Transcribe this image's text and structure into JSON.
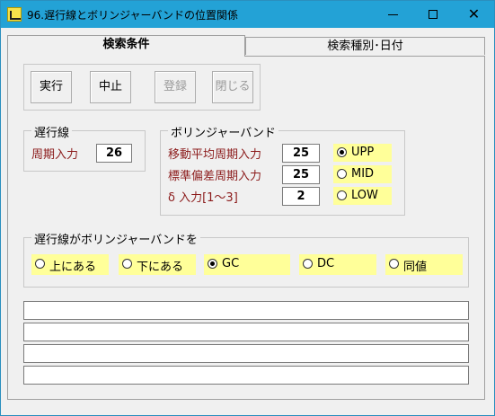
{
  "window": {
    "title": "96.遅行線とボリンジャーバンドの位置関係"
  },
  "tabs": [
    {
      "label": "検索条件",
      "active": true
    },
    {
      "label": "検索種別･日付",
      "active": false
    }
  ],
  "actions": {
    "run": "実行",
    "stop": "中止",
    "register": "登録",
    "close": "閉じる"
  },
  "lagging_line": {
    "group_title": "遅行線",
    "period_label": "周期入力",
    "period_value": "26"
  },
  "bollinger": {
    "group_title": "ボリンジャーバンド",
    "ma_period_label": "移動平均周期入力",
    "ma_period_value": "25",
    "sd_period_label": "標準偏差周期入力",
    "sd_period_value": "25",
    "delta_label": "δ 入力[1～3]",
    "delta_value": "2",
    "bands": [
      {
        "label": "UPP",
        "checked": true
      },
      {
        "label": "MID",
        "checked": false
      },
      {
        "label": "LOW",
        "checked": false
      }
    ]
  },
  "position": {
    "group_title": "遅行線がボリンジャーバンドを",
    "options": [
      {
        "label": "上にある",
        "checked": false
      },
      {
        "label": "下にある",
        "checked": false
      },
      {
        "label": "GC",
        "checked": true
      },
      {
        "label": "DC",
        "checked": false
      },
      {
        "label": "同値",
        "checked": false
      }
    ]
  },
  "output_lines": [
    "",
    "",
    "",
    ""
  ]
}
